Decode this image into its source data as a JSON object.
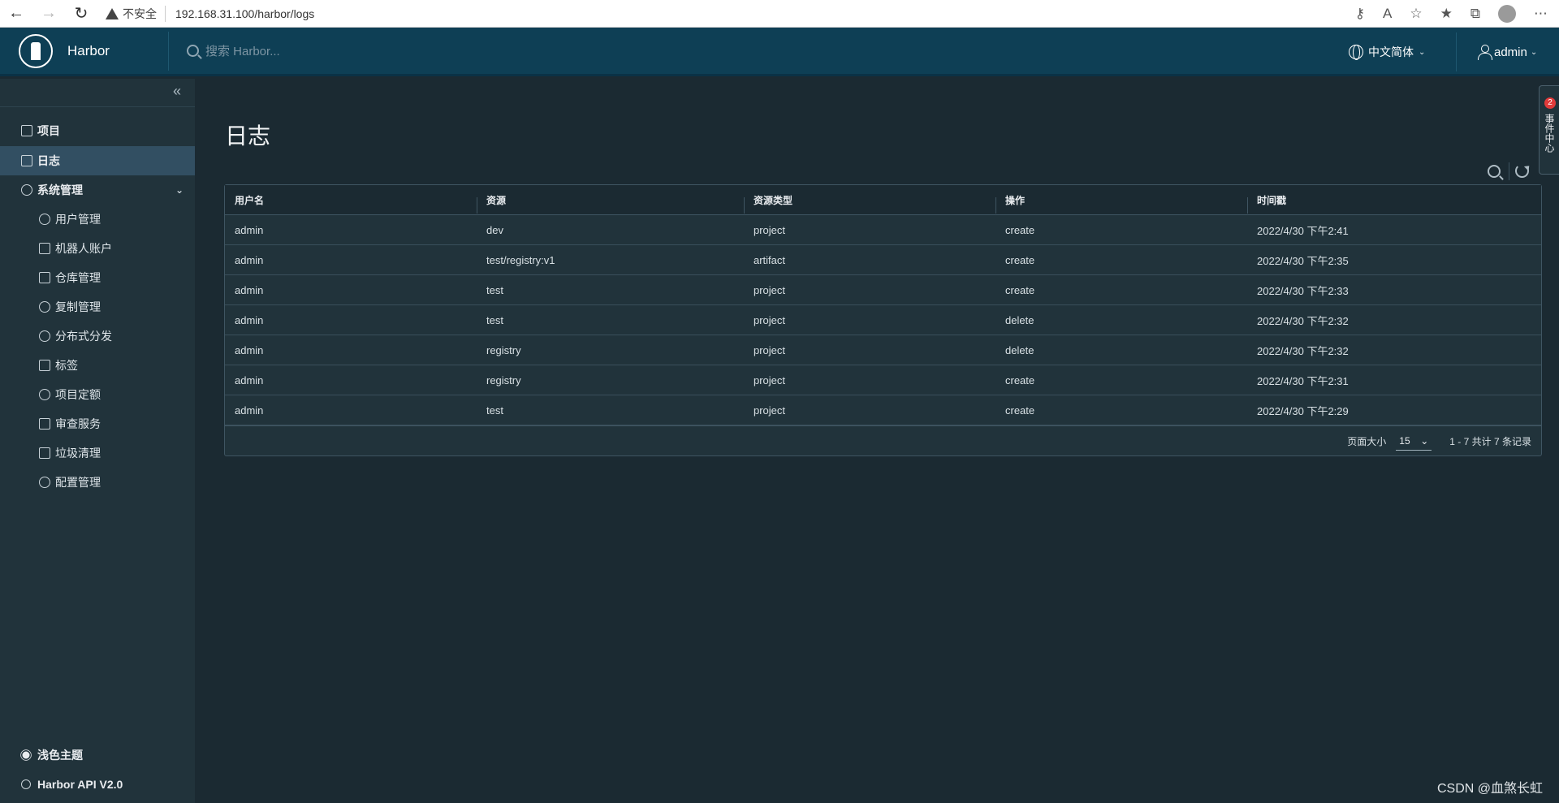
{
  "browser": {
    "security_label": "不安全",
    "url": "192.168.31.100/harbor/logs"
  },
  "header": {
    "brand": "Harbor",
    "search_placeholder": "搜索 Harbor...",
    "language": "中文简体",
    "user": "admin"
  },
  "sidebar": {
    "items": [
      {
        "label": "项目",
        "icon": "projects-icon"
      },
      {
        "label": "日志",
        "icon": "logs-icon"
      },
      {
        "label": "系统管理",
        "icon": "admin-icon"
      }
    ],
    "sub_items": [
      {
        "label": "用户管理",
        "icon": "users-icon"
      },
      {
        "label": "机器人账户",
        "icon": "robot-icon"
      },
      {
        "label": "仓库管理",
        "icon": "registry-icon"
      },
      {
        "label": "复制管理",
        "icon": "replication-icon"
      },
      {
        "label": "分布式分发",
        "icon": "distribution-icon"
      },
      {
        "label": "标签",
        "icon": "tag-icon"
      },
      {
        "label": "项目定额",
        "icon": "quota-icon"
      },
      {
        "label": "审查服务",
        "icon": "shield-icon"
      },
      {
        "label": "垃圾清理",
        "icon": "trash-icon"
      },
      {
        "label": "配置管理",
        "icon": "gear-icon"
      }
    ],
    "theme_label": "浅色主题",
    "api_label": "Harbor API V2.0"
  },
  "main": {
    "title": "日志",
    "columns": [
      "用户名",
      "资源",
      "资源类型",
      "操作",
      "时间戳"
    ],
    "rows": [
      [
        "admin",
        "dev",
        "project",
        "create",
        "2022/4/30 下午2:41"
      ],
      [
        "admin",
        "test/registry:v1",
        "artifact",
        "create",
        "2022/4/30 下午2:35"
      ],
      [
        "admin",
        "test",
        "project",
        "create",
        "2022/4/30 下午2:33"
      ],
      [
        "admin",
        "test",
        "project",
        "delete",
        "2022/4/30 下午2:32"
      ],
      [
        "admin",
        "registry",
        "project",
        "delete",
        "2022/4/30 下午2:32"
      ],
      [
        "admin",
        "registry",
        "project",
        "create",
        "2022/4/30 下午2:31"
      ],
      [
        "admin",
        "test",
        "project",
        "create",
        "2022/4/30 下午2:29"
      ]
    ],
    "footer": {
      "page_size_label": "页面大小",
      "page_size_value": "15",
      "range_info": "1 - 7 共计 7 条记录"
    }
  },
  "side_tab": {
    "badge": "2",
    "label": "事件中心"
  },
  "watermark": "CSDN @血煞长虹",
  "colors": {
    "header_bg": "#0e3f55",
    "sidebar_bg": "#21333b",
    "page_bg": "#1b2a32",
    "active_item_bg": "#324f62"
  }
}
